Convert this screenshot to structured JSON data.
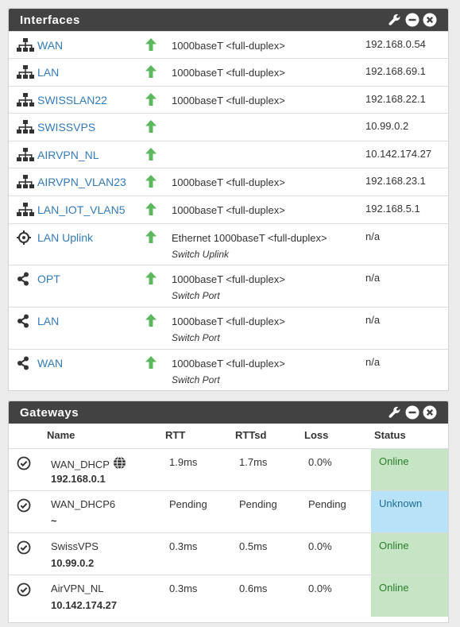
{
  "interfaces": {
    "title": "Interfaces",
    "rows": [
      {
        "name": "WAN",
        "icon": "network-icon",
        "media": "1000baseT <full-duplex>",
        "sub": "",
        "ip": "192.168.0.54"
      },
      {
        "name": "LAN",
        "icon": "network-icon",
        "media": "1000baseT <full-duplex>",
        "sub": "",
        "ip": "192.168.69.1"
      },
      {
        "name": "SWISSLAN22",
        "icon": "network-icon",
        "media": "1000baseT <full-duplex>",
        "sub": "",
        "ip": "192.168.22.1"
      },
      {
        "name": "SWISSVPS",
        "icon": "network-icon",
        "media": "",
        "sub": "",
        "ip": "10.99.0.2"
      },
      {
        "name": "AIRVPN_NL",
        "icon": "network-icon",
        "media": "",
        "sub": "",
        "ip": "10.142.174.27"
      },
      {
        "name": "AIRVPN_VLAN23",
        "icon": "network-icon",
        "media": "1000baseT <full-duplex>",
        "sub": "",
        "ip": "192.168.23.1"
      },
      {
        "name": "LAN_IOT_VLAN5",
        "icon": "network-icon",
        "media": "1000baseT <full-duplex>",
        "sub": "",
        "ip": "192.168.5.1"
      },
      {
        "name": "LAN Uplink",
        "icon": "crosshair-icon",
        "media": "Ethernet 1000baseT <full-duplex>",
        "sub": "Switch Uplink",
        "ip": "n/a"
      },
      {
        "name": "OPT",
        "icon": "share-icon",
        "media": "1000baseT <full-duplex>",
        "sub": "Switch Port",
        "ip": "n/a"
      },
      {
        "name": "LAN",
        "icon": "share-icon",
        "media": "1000baseT <full-duplex>",
        "sub": "Switch Port",
        "ip": "n/a"
      },
      {
        "name": "WAN",
        "icon": "share-icon",
        "media": "1000baseT <full-duplex>",
        "sub": "Switch Port",
        "ip": "n/a"
      }
    ]
  },
  "gateways": {
    "title": "Gateways",
    "columns": {
      "name": "Name",
      "rtt": "RTT",
      "rttsd": "RTTsd",
      "loss": "Loss",
      "status": "Status"
    },
    "rows": [
      {
        "name": "WAN_DHCP",
        "ip": "192.168.0.1",
        "rtt": "1.9ms",
        "rttsd": "1.7ms",
        "loss": "0.0%",
        "status": "Online",
        "state": "online",
        "globe": true
      },
      {
        "name": "WAN_DHCP6",
        "ip": "~",
        "rtt": "Pending",
        "rttsd": "Pending",
        "loss": "Pending",
        "status": "Unknown",
        "state": "unknown",
        "globe": false
      },
      {
        "name": "SwissVPS",
        "ip": "10.99.0.2",
        "rtt": "0.3ms",
        "rttsd": "0.5ms",
        "loss": "0.0%",
        "status": "Online",
        "state": "online",
        "globe": false
      },
      {
        "name": "AirVPN_NL",
        "ip": "10.142.174.27",
        "rtt": "0.3ms",
        "rttsd": "0.6ms",
        "loss": "0.0%",
        "status": "Online",
        "state": "online",
        "globe": false
      }
    ]
  },
  "colors": {
    "link": "#337ab7",
    "status_up": "#5cb85c",
    "online_bg": "#c5e5c5",
    "unknown_bg": "#b8e2f7",
    "header_bg": "#424242"
  }
}
